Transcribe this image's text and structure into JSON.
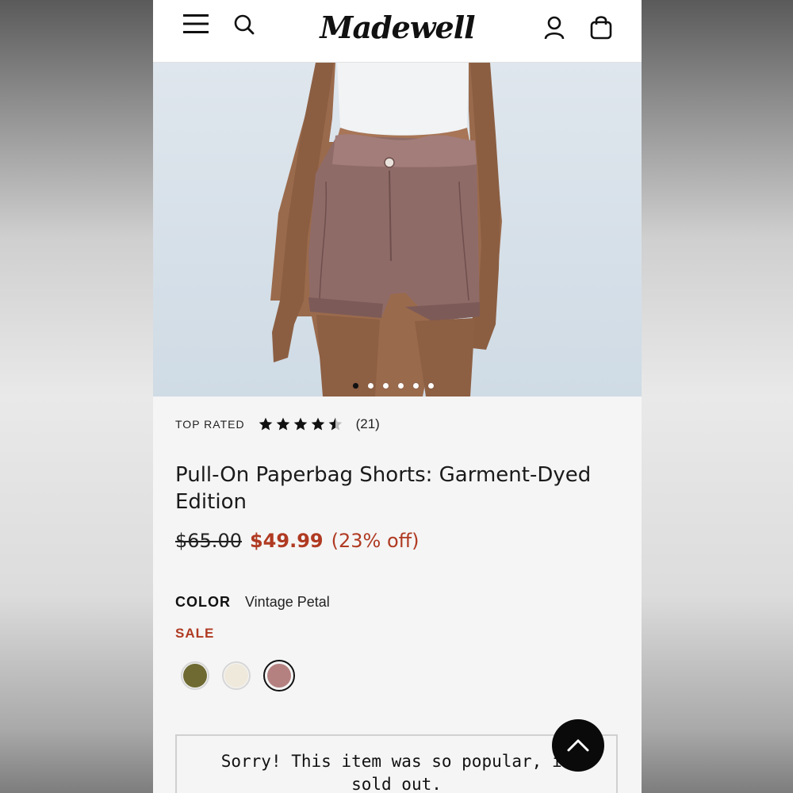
{
  "header": {
    "logo_text": "Madewell",
    "menu_icon": "hamburger-menu-icon",
    "search_icon": "search-icon",
    "account_icon": "user-icon",
    "bag_icon": "shopping-bag-icon"
  },
  "gallery": {
    "image_count": 6,
    "active_index": 0,
    "expand_icon": "expand-icon"
  },
  "rating": {
    "label": "TOP RATED",
    "stars": 4.5,
    "review_count": "(21)"
  },
  "product": {
    "title": "Pull-On Paperbag Shorts: Garment-Dyed Edition",
    "original_price": "$65.00",
    "sale_price": "$49.99",
    "discount": "(23% off)"
  },
  "color": {
    "label": "COLOR",
    "selected": "Vintage Petal",
    "sale_label": "SALE",
    "swatches": [
      {
        "color": "#6e6a32"
      },
      {
        "color": "#efe9dc"
      },
      {
        "color": "#b48180"
      }
    ]
  },
  "message": {
    "line1": "Sorry! This item was so popular, it",
    "line2": "sold out."
  },
  "colors": {
    "sale": "#b03a22",
    "text": "#1a1a1a"
  }
}
